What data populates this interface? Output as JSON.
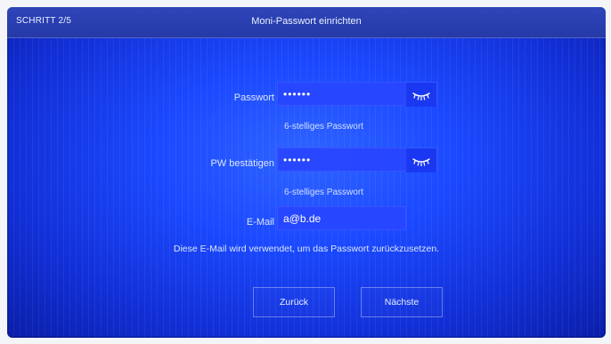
{
  "header": {
    "step": "SCHRITT 2/5",
    "title": "Moni-Passwort einrichten"
  },
  "form": {
    "password": {
      "label": "Passwort",
      "value_masked": "••••••",
      "hint": "6-stelliges Passwort"
    },
    "confirm_password": {
      "label": "PW bestätigen",
      "value_masked": "••••••",
      "hint": "6-stelliges Passwort"
    },
    "email": {
      "label": "E-Mail",
      "value": "a@b.de"
    },
    "info_text": "Diese E-Mail wird verwendet, um das Passwort zurückzusetzen."
  },
  "buttons": {
    "back": "Zurück",
    "next": "Nächste"
  },
  "icons": {
    "password_visibility": "eye-closed-icon",
    "confirm_password_visibility": "eye-closed-icon"
  },
  "colors": {
    "screen_blue": "#1b49ff",
    "topbar_blue": "#2539a7",
    "text_light": "#e9f1ff"
  }
}
